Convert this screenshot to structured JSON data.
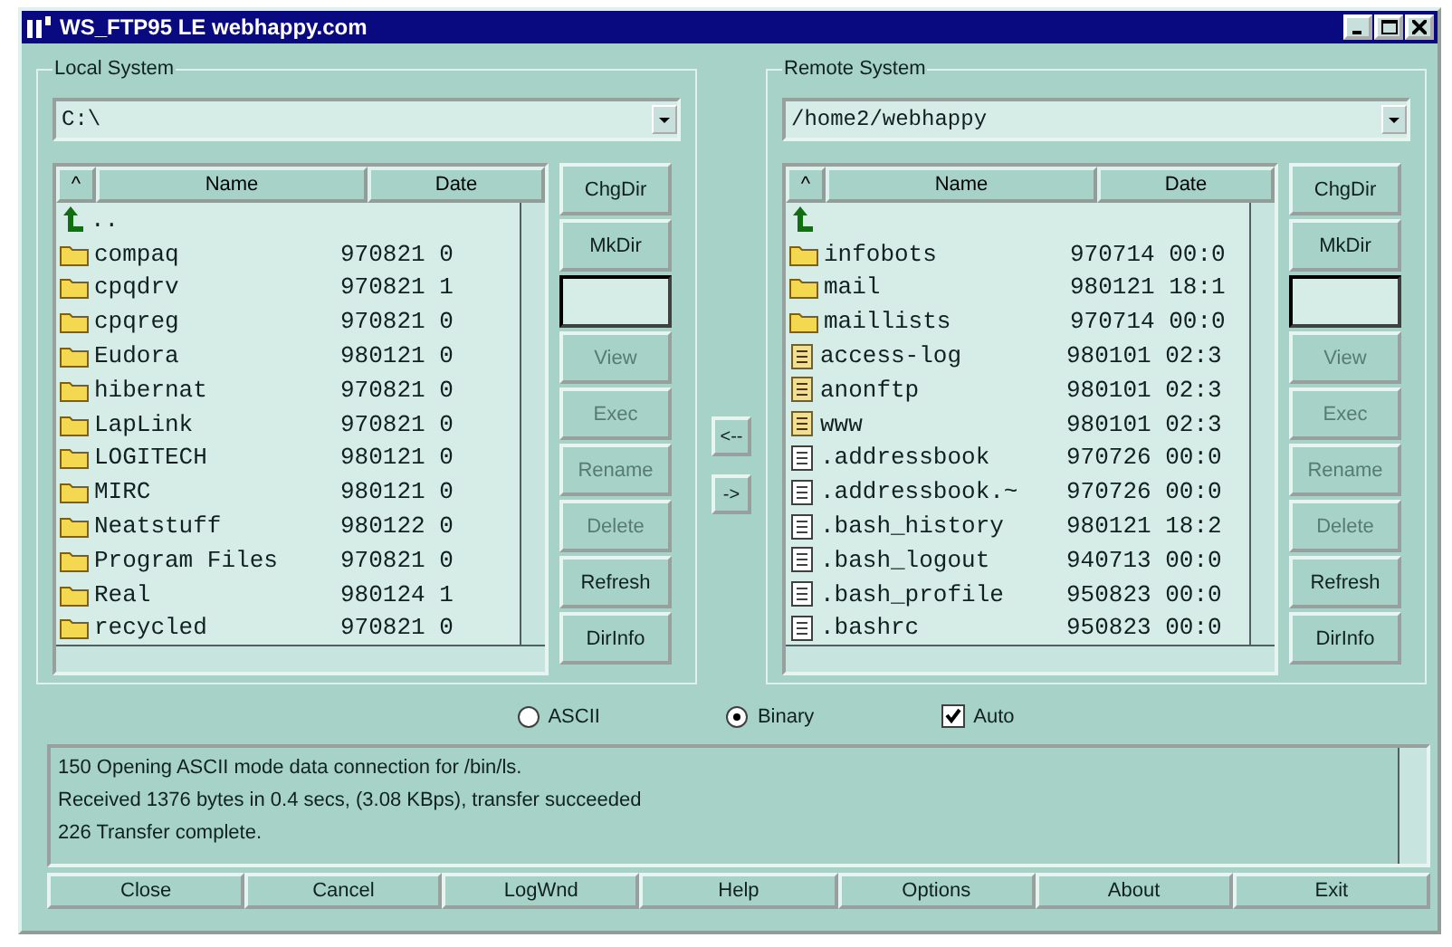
{
  "window": {
    "title": "WS_FTP95 LE webhappy.com"
  },
  "panels": [
    {
      "title": "Local System",
      "path": "C:\\",
      "columns": [
        "^",
        "Name",
        "Date"
      ],
      "files": [
        {
          "kind": "up",
          "name": ".."
        },
        {
          "kind": "folder",
          "name": "compaq",
          "date": "970821 0"
        },
        {
          "kind": "folder",
          "name": "cpqdrv",
          "date": "970821 1"
        },
        {
          "kind": "folder",
          "name": "cpqreg",
          "date": "970821 0"
        },
        {
          "kind": "folder",
          "name": "Eudora",
          "date": "980121 0"
        },
        {
          "kind": "folder",
          "name": "hibernat",
          "date": "970821 0"
        },
        {
          "kind": "folder",
          "name": "LapLink",
          "date": "970821 0"
        },
        {
          "kind": "folder",
          "name": "LOGITECH",
          "date": "980121 0"
        },
        {
          "kind": "folder",
          "name": "MIRC",
          "date": "980121 0"
        },
        {
          "kind": "folder",
          "name": "Neatstuff",
          "date": "980122 0"
        },
        {
          "kind": "folder",
          "name": "Program Files",
          "date": "970821 0"
        },
        {
          "kind": "folder",
          "name": "Real",
          "date": "980124 1"
        },
        {
          "kind": "folder",
          "name": "recycled",
          "date": "970821 0"
        }
      ],
      "buttons": [
        {
          "kind": "button",
          "label": "ChgDir",
          "disabled": false
        },
        {
          "kind": "button",
          "label": "MkDir",
          "disabled": false
        },
        {
          "kind": "field"
        },
        {
          "kind": "button",
          "label": "View",
          "disabled": true
        },
        {
          "kind": "button",
          "label": "Exec",
          "disabled": true
        },
        {
          "kind": "button",
          "label": "Rename",
          "disabled": true
        },
        {
          "kind": "button",
          "label": "Delete",
          "disabled": true
        },
        {
          "kind": "button",
          "label": "Refresh",
          "disabled": false
        },
        {
          "kind": "button",
          "label": "DirInfo",
          "disabled": false
        }
      ]
    },
    {
      "title": "Remote System",
      "path": "/home2/webhappy",
      "columns": [
        "^",
        "Name",
        "Date"
      ],
      "files": [
        {
          "kind": "up"
        },
        {
          "kind": "folder",
          "name": "infobots",
          "date": "970714 00:0"
        },
        {
          "kind": "folder",
          "name": "mail",
          "date": "980121 18:1"
        },
        {
          "kind": "folder",
          "name": "maillists",
          "date": "970714 00:0"
        },
        {
          "kind": "link",
          "name": "access-log",
          "date": "980101 02:3"
        },
        {
          "kind": "link",
          "name": "anonftp",
          "date": "980101 02:3"
        },
        {
          "kind": "link",
          "name": "www",
          "date": "980101 02:3"
        },
        {
          "kind": "file",
          "name": ".addressbook",
          "date": "970726 00:0"
        },
        {
          "kind": "file",
          "name": ".addressbook.~",
          "date": "970726 00:0"
        },
        {
          "kind": "file",
          "name": ".bash_history",
          "date": "980121 18:2"
        },
        {
          "kind": "file",
          "name": ".bash_logout",
          "date": "940713 00:0"
        },
        {
          "kind": "file",
          "name": ".bash_profile",
          "date": "950823 00:0"
        },
        {
          "kind": "file",
          "name": ".bashrc",
          "date": "950823 00:0"
        }
      ],
      "buttons": [
        {
          "kind": "button",
          "label": "ChgDir",
          "disabled": false
        },
        {
          "kind": "button",
          "label": "MkDir",
          "disabled": false
        },
        {
          "kind": "field"
        },
        {
          "kind": "button",
          "label": "View",
          "disabled": true
        },
        {
          "kind": "button",
          "label": "Exec",
          "disabled": true
        },
        {
          "kind": "button",
          "label": "Rename",
          "disabled": true
        },
        {
          "kind": "button",
          "label": "Delete",
          "disabled": true
        },
        {
          "kind": "button",
          "label": "Refresh",
          "disabled": false
        },
        {
          "kind": "button",
          "label": "DirInfo",
          "disabled": false
        }
      ]
    }
  ],
  "transfer_buttons": [
    "<--",
    "->"
  ],
  "modes": [
    {
      "label": "ASCII",
      "selected": false
    },
    {
      "label": "Binary",
      "selected": true
    }
  ],
  "auto": {
    "label": "Auto",
    "checked": true
  },
  "log": [
    "150 Opening ASCII mode data connection for /bin/ls.",
    "Received 1376 bytes in 0.4 secs, (3.08 KBps), transfer succeeded",
    "226 Transfer complete."
  ],
  "bottom_buttons": [
    "Close",
    "Cancel",
    "LogWnd",
    "Help",
    "Options",
    "About",
    "Exit"
  ]
}
